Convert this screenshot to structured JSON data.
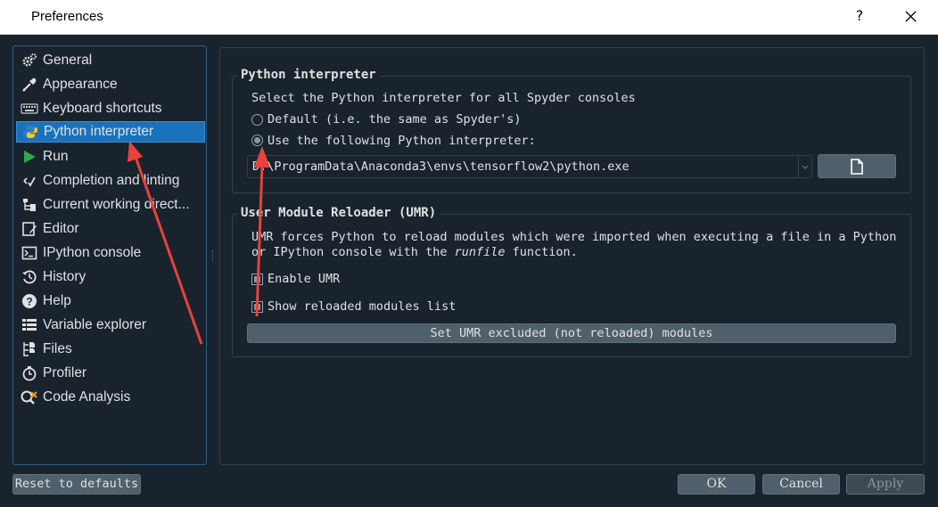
{
  "window": {
    "title": "Preferences",
    "help_glyph": "?"
  },
  "sidebar": {
    "items": [
      {
        "label": "General",
        "icon": "gears-icon"
      },
      {
        "label": "Appearance",
        "icon": "eyedropper-icon"
      },
      {
        "label": "Keyboard shortcuts",
        "icon": "keyboard-icon"
      },
      {
        "label": "Python interpreter",
        "icon": "python-icon",
        "selected": true
      },
      {
        "label": "Run",
        "icon": "play-icon"
      },
      {
        "label": "Completion and linting",
        "icon": "completion-icon"
      },
      {
        "label": "Current working direct...",
        "icon": "folder-tree-icon"
      },
      {
        "label": "Editor",
        "icon": "editor-icon"
      },
      {
        "label": "IPython console",
        "icon": "terminal-icon"
      },
      {
        "label": "History",
        "icon": "history-icon"
      },
      {
        "label": "Help",
        "icon": "help-circle-icon"
      },
      {
        "label": "Variable explorer",
        "icon": "table-icon"
      },
      {
        "label": "Files",
        "icon": "files-icon"
      },
      {
        "label": "Profiler",
        "icon": "stopwatch-icon"
      },
      {
        "label": "Code Analysis",
        "icon": "code-analysis-icon"
      }
    ]
  },
  "interpreter_group": {
    "title": "Python interpreter",
    "description": "Select the Python interpreter for all Spyder consoles",
    "option_default": "Default (i.e. the same as Spyder's)",
    "option_custom": "Use the following Python interpreter:",
    "selected_option": "custom",
    "path_value": "D:\\ProgramData\\Anaconda3\\envs\\tensorflow2\\python.exe"
  },
  "umr_group": {
    "title": "User Module Reloader (UMR)",
    "description_line1": "UMR forces Python to reload modules which were imported when executing a file in a Python",
    "description_line2_pre": "or IPython console with the ",
    "description_line2_em": "runfile",
    "description_line2_post": " function.",
    "enable_label": "Enable UMR",
    "enable_checked": true,
    "show_reloaded_label": "Show reloaded modules list",
    "show_reloaded_checked": true,
    "excluded_button": "Set UMR excluded (not reloaded) modules"
  },
  "footer": {
    "reset_button": "Reset to defaults",
    "ok_button": "OK",
    "cancel_button": "Cancel",
    "apply_button": "Apply"
  },
  "colors": {
    "background": "#19232d",
    "selection": "#1a72bb",
    "annotation_arrow": "#e8423a"
  }
}
